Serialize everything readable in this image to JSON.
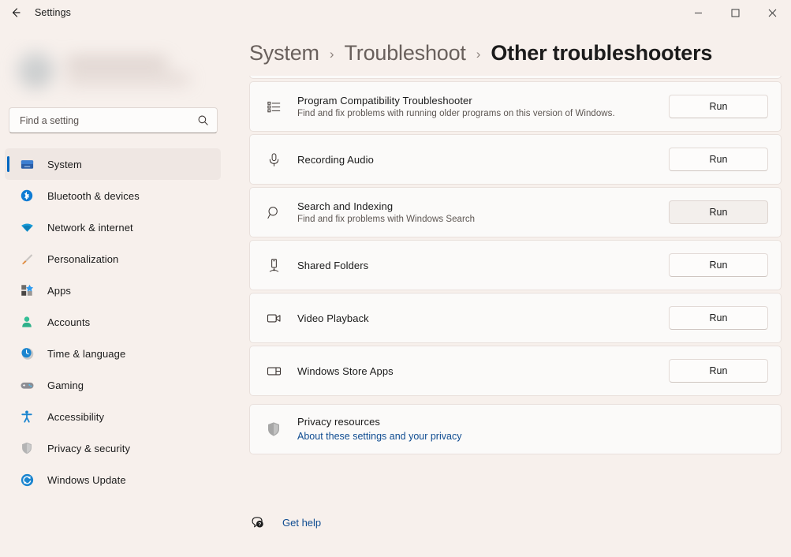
{
  "window": {
    "app_title": "Settings",
    "back_icon": "back-arrow-icon",
    "controls": {
      "minimize": "minimize-icon",
      "maximize": "maximize-icon",
      "close": "close-icon"
    }
  },
  "sidebar": {
    "profile": {
      "redacted": true
    },
    "search": {
      "placeholder": "Find a setting",
      "value": "",
      "icon": "search-icon"
    },
    "items": [
      {
        "label": "System",
        "icon": "monitor-icon",
        "selected": true
      },
      {
        "label": "Bluetooth & devices",
        "icon": "bluetooth-icon",
        "selected": false
      },
      {
        "label": "Network & internet",
        "icon": "wifi-icon",
        "selected": false
      },
      {
        "label": "Personalization",
        "icon": "paintbrush-icon",
        "selected": false
      },
      {
        "label": "Apps",
        "icon": "apps-grid-icon",
        "selected": false
      },
      {
        "label": "Accounts",
        "icon": "person-icon",
        "selected": false
      },
      {
        "label": "Time & language",
        "icon": "clock-globe-icon",
        "selected": false
      },
      {
        "label": "Gaming",
        "icon": "gamepad-icon",
        "selected": false
      },
      {
        "label": "Accessibility",
        "icon": "accessibility-person-icon",
        "selected": false
      },
      {
        "label": "Privacy & security",
        "icon": "shield-icon",
        "selected": false
      },
      {
        "label": "Windows Update",
        "icon": "update-refresh-icon",
        "selected": false
      }
    ]
  },
  "breadcrumb": {
    "separator": "›",
    "items": [
      {
        "label": "System",
        "current": false
      },
      {
        "label": "Troubleshoot",
        "current": false
      },
      {
        "label": "Other troubleshooters",
        "current": true
      }
    ]
  },
  "troubleshooters": [
    {
      "title": "Program Compatibility Troubleshooter",
      "subtitle": "Find and fix problems with running older programs on this version of Windows.",
      "icon": "bullet-list-icon",
      "action": "Run",
      "hovered": false
    },
    {
      "title": "Recording Audio",
      "subtitle": "",
      "icon": "microphone-icon",
      "action": "Run",
      "hovered": false
    },
    {
      "title": "Search and Indexing",
      "subtitle": "Find and fix problems with Windows Search",
      "icon": "magnifier-icon",
      "action": "Run",
      "hovered": true
    },
    {
      "title": "Shared Folders",
      "subtitle": "",
      "icon": "shared-folder-icon",
      "action": "Run",
      "hovered": false
    },
    {
      "title": "Video Playback",
      "subtitle": "",
      "icon": "video-camera-icon",
      "action": "Run",
      "hovered": false
    },
    {
      "title": "Windows Store Apps",
      "subtitle": "",
      "icon": "store-panel-icon",
      "action": "Run",
      "hovered": false
    }
  ],
  "privacy": {
    "title": "Privacy resources",
    "link": "About these settings and your privacy",
    "icon": "shield-icon"
  },
  "help": {
    "label": "Get help",
    "icon": "question-bubble-icon"
  },
  "colors": {
    "background": "#f7f0ec",
    "card": "#fbfaf9",
    "accent": "#0067c0",
    "link": "#0f4c91",
    "selected_row": "#efe7e3"
  }
}
